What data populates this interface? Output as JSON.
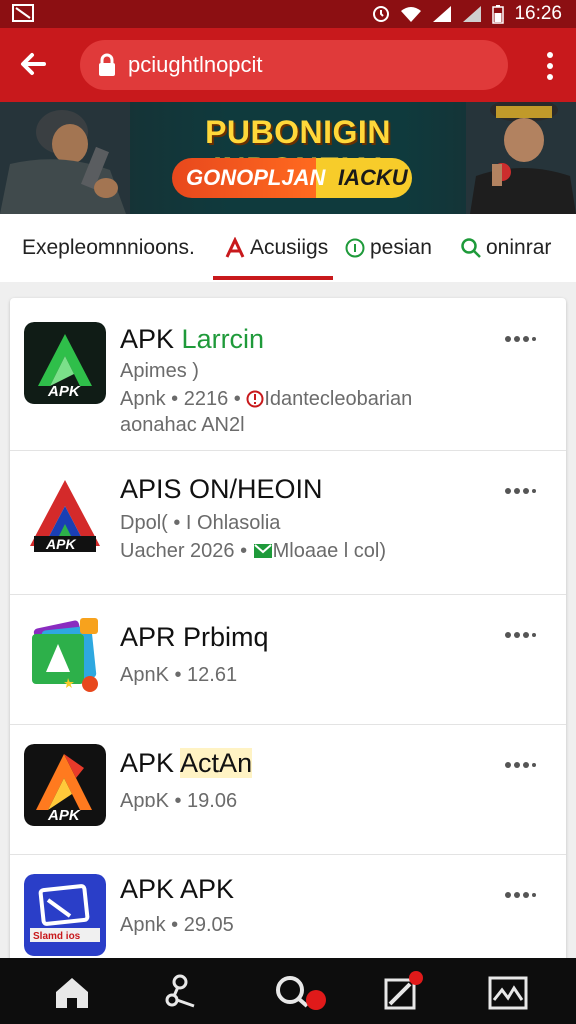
{
  "status_bar": {
    "time": "16:26"
  },
  "browser": {
    "url": "pciughtlnopcit"
  },
  "banner": {
    "title": "PUBONIGIN INDONEIAI",
    "pill_left": "GONOPLJAN",
    "pill_right": "IACKU"
  },
  "tabs": [
    {
      "label": "Exepleomnnioons."
    },
    {
      "label": "Acusiigs"
    },
    {
      "label": "pesian"
    },
    {
      "label": "oninrar"
    }
  ],
  "apps": [
    {
      "name": "APK",
      "name_accent": "Larrcin",
      "accent_color": "#1f9a3a",
      "icon_text": "APK",
      "lines": [
        "Apimes )",
        "Apnk • 2216 • ",
        "aonahac AN2l"
      ],
      "line2_icon_text": "Idantecleobarian"
    },
    {
      "name": "APIS ON/HEOIN",
      "name_accent": "",
      "icon_text": "APK",
      "lines": [
        "Dpol( • I Ohlasolia",
        "Uacher 2026 • ",
        ""
      ],
      "line2_icon_text": "Mloaae  l col)"
    },
    {
      "name": "APR Prbimq",
      "name_accent": "",
      "icon_text": "",
      "lines": [
        "ApnK • 12.61",
        "",
        ""
      ]
    },
    {
      "name": "APK",
      "name_accent": "ActAn",
      "accent_color": "#1a1a1a",
      "icon_text": "APK",
      "lines": [
        "ApɒK • 19.06",
        "",
        ""
      ]
    },
    {
      "name": "APK APK",
      "name_accent": "",
      "icon_text": "Slamd ios",
      "lines": [
        "Apnk • 29.05",
        "",
        ""
      ]
    }
  ],
  "nav": [
    "home-icon",
    "share-icon",
    "search-icon",
    "edit-icon",
    "gallery-icon"
  ],
  "colors": {
    "primary": "#c8191c",
    "dark_status": "#8c0f12"
  }
}
